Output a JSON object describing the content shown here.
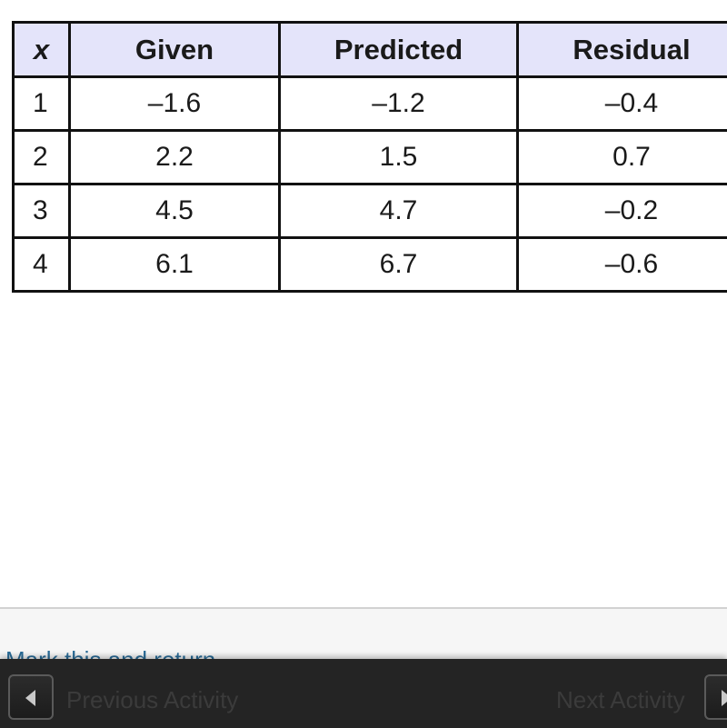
{
  "table": {
    "headers": [
      "x",
      "Given",
      "Predicted",
      "Residual"
    ],
    "rows": [
      {
        "x": "1",
        "given": "–1.6",
        "predicted": "–1.2",
        "residual": "–0.4"
      },
      {
        "x": "2",
        "given": "2.2",
        "predicted": "1.5",
        "residual": "0.7"
      },
      {
        "x": "3",
        "given": "4.5",
        "predicted": "4.7",
        "residual": "–0.2"
      },
      {
        "x": "4",
        "given": "6.1",
        "predicted": "6.7",
        "residual": "–0.6"
      }
    ],
    "header_bg": "#e4e4fa"
  },
  "footer": {
    "mark_link": "Mark this and return",
    "previous_label": "Previous Activity",
    "next_label": "Next Activity",
    "bar_color": "#242424",
    "link_color": "#2a6c98"
  }
}
